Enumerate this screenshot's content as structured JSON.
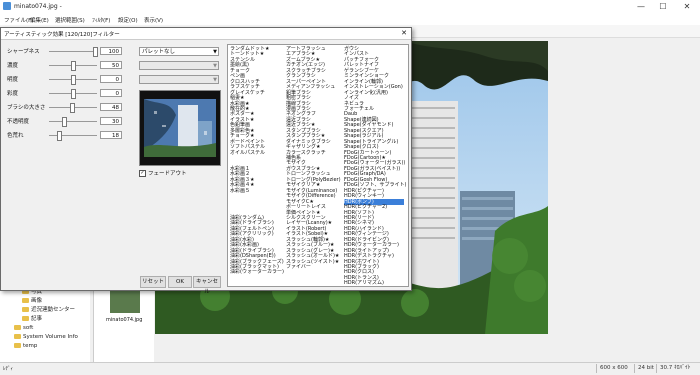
{
  "window": {
    "title": "minato074.jpg - ",
    "min": "—",
    "max": "☐",
    "close": "✕"
  },
  "menu": [
    "ファイル(F)",
    "編集(E)",
    "選択範囲(S)",
    "ﾌｨﾙﾀ(F)",
    "設定(O)",
    "表示(V)"
  ],
  "dialog": {
    "title": "アーティスティック効果 [120/120]フィルター",
    "close": "✕",
    "sliders": [
      {
        "label": "シャープネス",
        "value": "100",
        "level": 1.0
      },
      {
        "label": "濃度",
        "value": "50",
        "level": 0.5
      },
      {
        "label": "明度",
        "value": "0",
        "level": 0.5
      },
      {
        "label": "彩度",
        "value": "0",
        "level": 0.5
      },
      {
        "label": "ブラシの大きさ",
        "value": "48",
        "level": 0.48
      },
      {
        "label": "不透明度",
        "value": "30",
        "level": 0.3
      },
      {
        "label": "色荒れ",
        "value": "18",
        "level": 0.18
      }
    ],
    "combo1": "パレットなし",
    "checkbox_label": "フェードアウト",
    "checkbox_mark": "✓",
    "btn_reset": "リセット",
    "btn_ok": "OK",
    "btn_cancel": "キャンセル",
    "filters": [
      [
        "ランダムドット★",
        "トーンドット★",
        "ステンシル",
        "墨絵(黒)",
        "チョーク",
        "ペン画",
        "クロスハッチ",
        "ラフスケッチ",
        "グレイスケッチ",
        "稲妻★",
        "水彩画★",
        "散在的★",
        "ポスター★",
        "イラスト★",
        "色鉛筆画",
        "多層彩色★",
        "チョーク★",
        "ボードペイント",
        "ソフトパステル",
        "オイルパステル",
        "",
        "",
        "水彩画１",
        "水彩画２",
        "水彩画３★",
        "水彩画４★",
        "水彩画５",
        "",
        "",
        "",
        "",
        "油彩(ランダム)",
        "油彩(ドライブラシ)",
        "油彩(フェルトペン)",
        "油彩(アクリリック)",
        "油彩(水彩)",
        "油彩(水彩画)",
        "油彩(ドライブラシ)",
        "油彩(DSharpen(E))",
        "油彩(ブラックフェーズ)",
        "油彩(ブラックマット)",
        "油彩(ウォーターカラー)"
      ],
      [
        "アートフラッシュ",
        "エアブラシ★",
        "ズームブラシ★",
        "カチオン(エッジ)",
        "スクラッチブラシ",
        "クランブラシ",
        "スーパーペイント",
        "メディアンフラッシュ",
        "鉛筆ブラシ",
        "粗密ブラシ",
        "描線ブラシ",
        "漫画ブラシ",
        "ネオングラフ",
        "遠近ブラシ",
        "遠近ブラシ★",
        "スタンプブラシ",
        "スタンプブラシ★",
        "ダイナミックブラシ",
        "ギャザリング★",
        "カラースクラッチ",
        "補色系",
        "モザイク",
        "ガウスブラシ★",
        "トローンフラッシュ",
        "トローング(PolyBezier)",
        "モザイクリア★",
        "モザイク(Luminance)",
        "モザイク(Difference)",
        "モザイクC★",
        "ポーリートレイス",
        "単価ペイント★",
        "シルクスクリーン",
        "レイヤー(Lcanny)★",
        "イラスト(Robert)",
        "イラスト(Sobel)★",
        "スラッシュ(輪郭)★",
        "スラッシュ(ブルー)★",
        "スラッシュ(グレー)★",
        "スラッシュ(オールド)★",
        "スラッシュ(ツイスト)★",
        "ファイバー"
      ],
      [
        "ガウシ",
        "インパスト",
        "パッチフォーク",
        "パレットナイフ",
        "ゲランシブーケ",
        "ミンラインショーク",
        "インライン(輪郭)",
        "インストレーション(Gon)",
        "インライン化(汎用)",
        "ノイズ",
        "ネビュラ",
        "フォーチェル",
        "Daub",
        "Shape(連続図)",
        "Shape(ダイヤモンド)",
        "Shape(スクエア)",
        "Shape(ラジアル)",
        "Shape(トライアングル)",
        "Shape(クロス)",
        "FDoG(カートゥーン)",
        "FDoG(Cartoon)★",
        "FDoG(ウォーター(ガラス))",
        "FDoG(ガラス(ベイスト))",
        "FDoG(Graph/DA)",
        "FDoG(Gosh Flow)",
        "FDoG(ソフト、サブライト)",
        "HDR(ピクチャー)",
        "HDR(ウィンキー)",
        "HDR(ボンブ)",
        "HDR(ピクチャー2)",
        "HDR(ソフト)",
        "HDR(リード)",
        "HDR(シネマ)",
        "HDR(ハイランド)",
        "HDR(ヴィンテージ)",
        "HDR(ドライビング)",
        "HDR(ウォーターカラー)",
        "HDR(ライトアップ)",
        "HDR(デストラクチャ)",
        "HDR(ホワイト)",
        "HDR(ブラック)",
        "HDR(クロス)",
        "HDR(トランス)",
        "HDR(アリマズム)"
      ]
    ],
    "selected_filter": "HDR(ボンブ)"
  },
  "tree": [
    "写真",
    "画像",
    "近況連動センター",
    "記事",
    "soft",
    "System Volume Info",
    "temp"
  ],
  "thumb_label": "minato074.jpg",
  "status": [
    "600 x 600",
    "24 bit",
    "30.7 ｷﾛﾊﾞｲﾄ"
  ],
  "status_left": "ﾚﾃﾞｨ"
}
